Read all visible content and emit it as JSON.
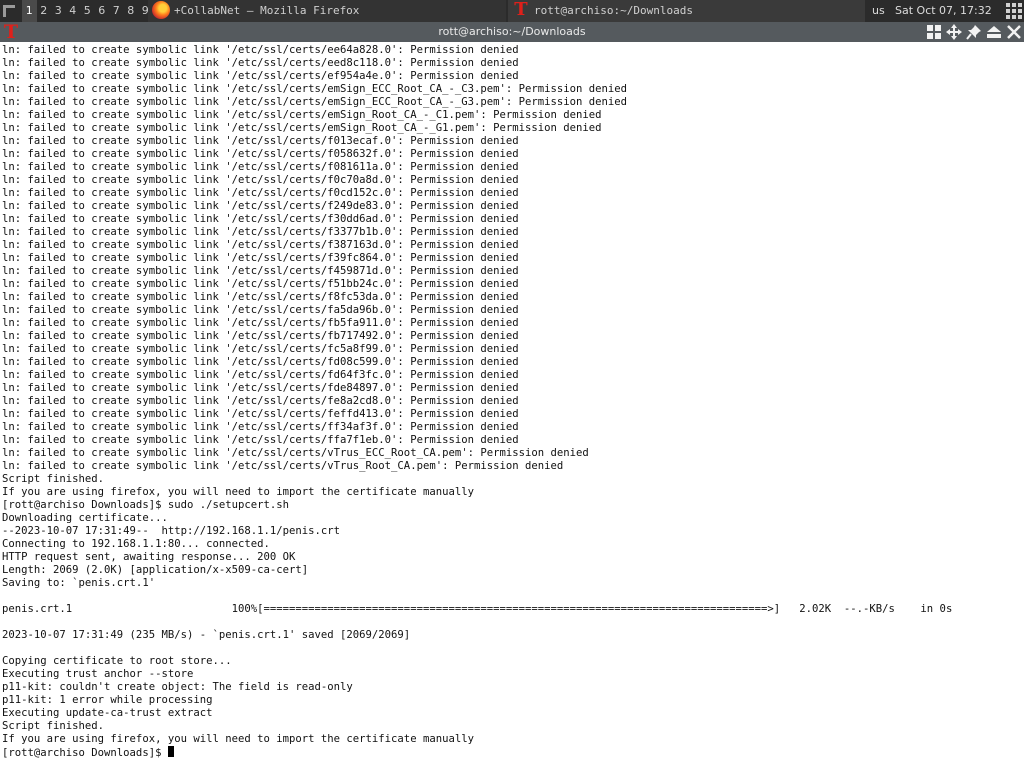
{
  "panel": {
    "workspaces": [
      "1",
      "2",
      "3",
      "4",
      "5",
      "6",
      "7",
      "8",
      "9"
    ],
    "active_workspace": "1",
    "tasks": [
      {
        "label": "+CollabNet — Mozilla Firefox",
        "icon": "firefox-icon"
      },
      {
        "label": "rott@archiso:~/Downloads",
        "icon": "terminal-icon"
      }
    ],
    "keyboard_layout": "us",
    "clock": "Sat Oct 07, 17:32"
  },
  "window": {
    "title": "rott@archiso:~/Downloads",
    "buttons": [
      "layout-grid-icon",
      "move-icon",
      "pin-icon",
      "maximize-icon",
      "close-icon"
    ]
  },
  "terminal": {
    "lines": [
      "ln: failed to create symbolic link '/etc/ssl/certs/ee64a828.0': Permission denied",
      "ln: failed to create symbolic link '/etc/ssl/certs/eed8c118.0': Permission denied",
      "ln: failed to create symbolic link '/etc/ssl/certs/ef954a4e.0': Permission denied",
      "ln: failed to create symbolic link '/etc/ssl/certs/emSign_ECC_Root_CA_-_C3.pem': Permission denied",
      "ln: failed to create symbolic link '/etc/ssl/certs/emSign_ECC_Root_CA_-_G3.pem': Permission denied",
      "ln: failed to create symbolic link '/etc/ssl/certs/emSign_Root_CA_-_C1.pem': Permission denied",
      "ln: failed to create symbolic link '/etc/ssl/certs/emSign_Root_CA_-_G1.pem': Permission denied",
      "ln: failed to create symbolic link '/etc/ssl/certs/f013ecaf.0': Permission denied",
      "ln: failed to create symbolic link '/etc/ssl/certs/f058632f.0': Permission denied",
      "ln: failed to create symbolic link '/etc/ssl/certs/f081611a.0': Permission denied",
      "ln: failed to create symbolic link '/etc/ssl/certs/f0c70a8d.0': Permission denied",
      "ln: failed to create symbolic link '/etc/ssl/certs/f0cd152c.0': Permission denied",
      "ln: failed to create symbolic link '/etc/ssl/certs/f249de83.0': Permission denied",
      "ln: failed to create symbolic link '/etc/ssl/certs/f30dd6ad.0': Permission denied",
      "ln: failed to create symbolic link '/etc/ssl/certs/f3377b1b.0': Permission denied",
      "ln: failed to create symbolic link '/etc/ssl/certs/f387163d.0': Permission denied",
      "ln: failed to create symbolic link '/etc/ssl/certs/f39fc864.0': Permission denied",
      "ln: failed to create symbolic link '/etc/ssl/certs/f459871d.0': Permission denied",
      "ln: failed to create symbolic link '/etc/ssl/certs/f51bb24c.0': Permission denied",
      "ln: failed to create symbolic link '/etc/ssl/certs/f8fc53da.0': Permission denied",
      "ln: failed to create symbolic link '/etc/ssl/certs/fa5da96b.0': Permission denied",
      "ln: failed to create symbolic link '/etc/ssl/certs/fb5fa911.0': Permission denied",
      "ln: failed to create symbolic link '/etc/ssl/certs/fb717492.0': Permission denied",
      "ln: failed to create symbolic link '/etc/ssl/certs/fc5a8f99.0': Permission denied",
      "ln: failed to create symbolic link '/etc/ssl/certs/fd08c599.0': Permission denied",
      "ln: failed to create symbolic link '/etc/ssl/certs/fd64f3fc.0': Permission denied",
      "ln: failed to create symbolic link '/etc/ssl/certs/fde84897.0': Permission denied",
      "ln: failed to create symbolic link '/etc/ssl/certs/fe8a2cd8.0': Permission denied",
      "ln: failed to create symbolic link '/etc/ssl/certs/feffd413.0': Permission denied",
      "ln: failed to create symbolic link '/etc/ssl/certs/ff34af3f.0': Permission denied",
      "ln: failed to create symbolic link '/etc/ssl/certs/ffa7f1eb.0': Permission denied",
      "ln: failed to create symbolic link '/etc/ssl/certs/vTrus_ECC_Root_CA.pem': Permission denied",
      "ln: failed to create symbolic link '/etc/ssl/certs/vTrus_Root_CA.pem': Permission denied",
      "Script finished.",
      "If you are using firefox, you will need to import the certificate manually",
      "[rott@archiso Downloads]$ sudo ./setupcert.sh",
      "Downloading certificate...",
      "--2023-10-07 17:31:49--  http://192.168.1.1/penis.crt",
      "Connecting to 192.168.1.1:80... connected.",
      "HTTP request sent, awaiting response... 200 OK",
      "Length: 2069 (2.0K) [application/x-x509-ca-cert]",
      "Saving to: `penis.crt.1'",
      "",
      "penis.crt.1                         100%[===============================================================================>]   2.02K  --.-KB/s    in 0s",
      "",
      "2023-10-07 17:31:49 (235 MB/s) - `penis.crt.1' saved [2069/2069]",
      "",
      "Copying certificate to root store...",
      "Executing trust anchor --store",
      "p11-kit: couldn't create object: The field is read-only",
      "p11-kit: 1 error while processing",
      "Executing update-ca-trust extract",
      "Script finished.",
      "If you are using firefox, you will need to import the certificate manually"
    ],
    "prompt": "[rott@archiso Downloads]$ "
  },
  "colors": {
    "panel_bg": "#2b2b2b",
    "titlebar_bg": "#555a5e",
    "terminal_bg": "#ffffff",
    "terminal_fg": "#111111",
    "terminal_icon": "#e0201a"
  }
}
